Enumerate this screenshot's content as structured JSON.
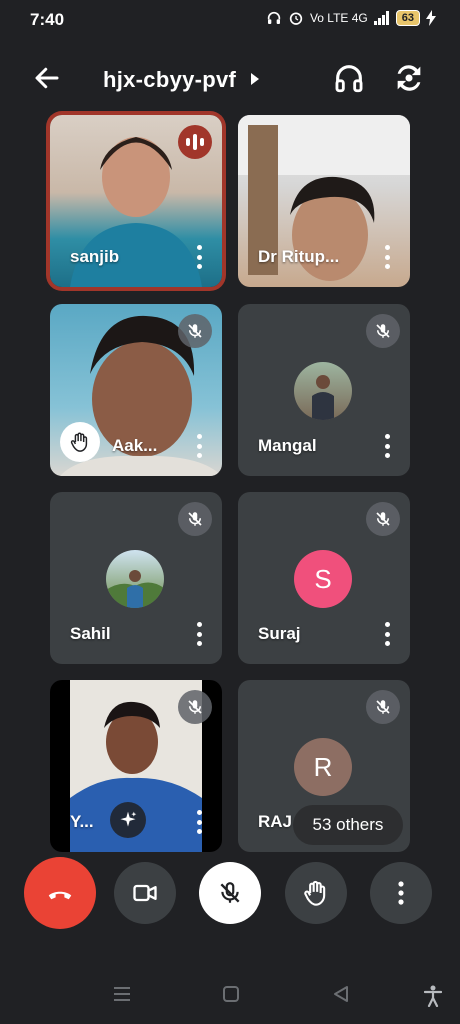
{
  "status_bar": {
    "time": "7:40",
    "network": "Vo LTE  4G",
    "battery": "63"
  },
  "meeting": {
    "code": "hjx-cbyy-pvf"
  },
  "participants": [
    {
      "name": "sanjib",
      "state": "speaking"
    },
    {
      "name": "Dr Ritup...",
      "state": "video"
    },
    {
      "name": "Aak...",
      "state": "muted-hand-raised"
    },
    {
      "name": "Mangal",
      "state": "muted"
    },
    {
      "name": "Sahil",
      "state": "muted"
    },
    {
      "name": "Suraj",
      "initial": "S",
      "state": "muted",
      "color": "#f0507c"
    },
    {
      "name": "Y...",
      "state": "muted-video"
    },
    {
      "name": "RAJ",
      "initial": "R",
      "state": "muted",
      "color": "#8d6e63"
    }
  ],
  "others_label": "53 others",
  "icons": {
    "back": "arrow-left-icon",
    "caret": "caret-right-icon",
    "audio": "headphones-icon",
    "switch_camera": "camera-switch-icon",
    "mute": "mic-off-icon",
    "more": "more-vert-icon",
    "hand": "hand-icon",
    "effects": "sparkle-icon",
    "end_call": "phone-hangup-icon",
    "camera": "videocam-icon",
    "mic": "mic-off-icon"
  },
  "colors": {
    "background": "#202124",
    "tile": "#3c4043",
    "speaking": "#a1362a",
    "end_call": "#ea4335"
  }
}
